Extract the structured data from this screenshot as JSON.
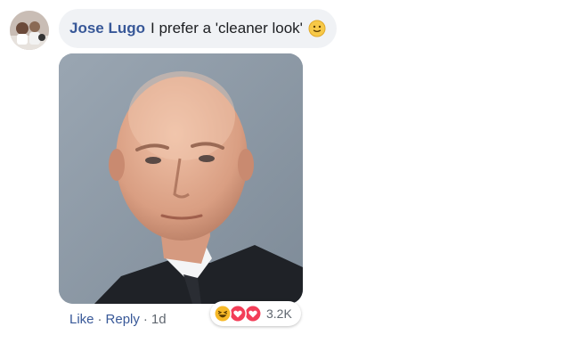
{
  "comment": {
    "author": "Jose Lugo",
    "text": "I prefer a 'cleaner look'",
    "inline_emoji": "slightly-smiling-face-icon"
  },
  "actions": {
    "like_label": "Like",
    "separator": "·",
    "reply_label": "Reply",
    "timestamp": "1d"
  },
  "reactions": {
    "types": [
      "haha-icon",
      "love-icon",
      "love-icon"
    ],
    "count": "3.2K"
  },
  "colors": {
    "author_link": "#385898",
    "bubble_bg": "#f0f2f5",
    "haha": "#f7b928",
    "love": "#f33e58"
  }
}
